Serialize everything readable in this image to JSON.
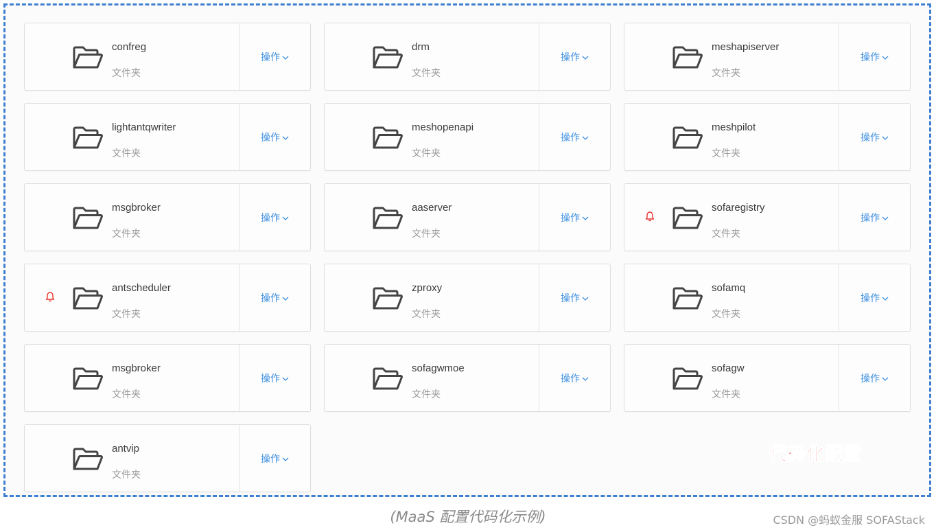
{
  "folders": [
    {
      "name": "confreg",
      "type": "文件夹",
      "action": "操作",
      "alert": false
    },
    {
      "name": "drm",
      "type": "文件夹",
      "action": "操作",
      "alert": false
    },
    {
      "name": "meshapiserver",
      "type": "文件夹",
      "action": "操作",
      "alert": false
    },
    {
      "name": "lightantqwriter",
      "type": "文件夹",
      "action": "操作",
      "alert": false
    },
    {
      "name": "meshopenapi",
      "type": "文件夹",
      "action": "操作",
      "alert": false
    },
    {
      "name": "meshpilot",
      "type": "文件夹",
      "action": "操作",
      "alert": false
    },
    {
      "name": "msgbroker",
      "type": "文件夹",
      "action": "操作",
      "alert": false
    },
    {
      "name": "aaserver",
      "type": "文件夹",
      "action": "操作",
      "alert": false
    },
    {
      "name": "sofaregistry",
      "type": "文件夹",
      "action": "操作",
      "alert": true
    },
    {
      "name": "antscheduler",
      "type": "文件夹",
      "action": "操作",
      "alert": true
    },
    {
      "name": "zproxy",
      "type": "文件夹",
      "action": "操作",
      "alert": false
    },
    {
      "name": "sofamq",
      "type": "文件夹",
      "action": "操作",
      "alert": false
    },
    {
      "name": "msgbroker",
      "type": "文件夹",
      "action": "操作",
      "alert": false
    },
    {
      "name": "sofagwmoe",
      "type": "文件夹",
      "action": "操作",
      "alert": false
    },
    {
      "name": "sofagw",
      "type": "文件夹",
      "action": "操作",
      "alert": false
    },
    {
      "name": "antvip",
      "type": "文件夹",
      "action": "操作",
      "alert": false
    }
  ],
  "stamp_text": "代码化配置",
  "caption": "(MaaS 配置代码化示例)",
  "credit": "CSDN @蚂蚁金服 SOFAStack",
  "colors": {
    "frame_border": "#3f7fd1",
    "action_link": "#3d8fe0",
    "alert_bell": "#e8322c",
    "stamp": "#e8322c"
  },
  "icons": {
    "folder": "folder-open-icon",
    "bell": "bell-icon",
    "chevron": "chevron-down-icon"
  }
}
